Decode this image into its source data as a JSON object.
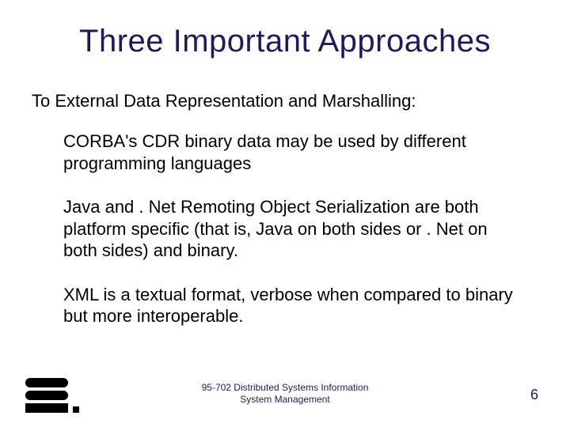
{
  "title": "Three Important Approaches",
  "subtitle": "To External Data Representation and Marshalling:",
  "body": {
    "p1": "CORBA's CDR binary data may be used by different programming languages",
    "p2": "Java and . Net Remoting Object Serialization are both platform specific (that is, Java on both sides or . Net on both sides) and binary.",
    "p3": "XML is a textual format, verbose when compared to binary but more interoperable."
  },
  "footer": {
    "line1": "95-702 Distributed Systems Information",
    "line2": "System Management"
  },
  "page_number": "6"
}
